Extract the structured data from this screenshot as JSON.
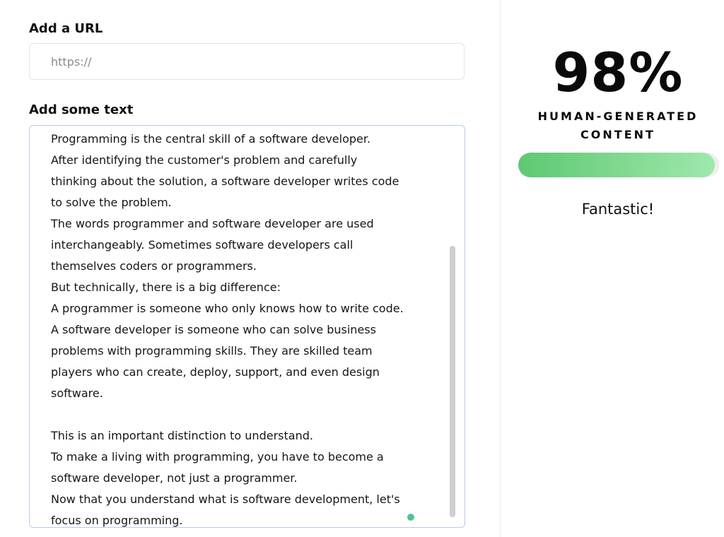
{
  "url_section": {
    "label": "Add a URL",
    "placeholder": "https://"
  },
  "text_section": {
    "label": "Add some text",
    "lines": [
      "Programming is the central skill of a software developer.",
      "After identifying the customer's problem and carefully",
      "thinking about the solution, a software developer writes code",
      "to solve the problem.",
      "The words programmer and software developer are used",
      "interchangeably. Sometimes software developers call",
      "themselves coders or programmers.",
      "But technically, there is a big difference:",
      "A programmer is someone who only knows how to write code.",
      "A software developer is someone who can solve business",
      "problems with programming skills. They are skilled team",
      "players who can create, deploy, support, and even design",
      "software.",
      "",
      "This is an important distinction to understand.",
      "To make a living with programming, you have to become a",
      "software developer, not just a programmer.",
      "Now that you understand what is software development, let's",
      "focus on programming."
    ]
  },
  "result": {
    "score": "98%",
    "caption_line1": "HUMAN-GENERATED",
    "caption_line2": "CONTENT",
    "progress_percent": 98,
    "verdict": "Fantastic!"
  },
  "colors": {
    "progress_start": "#5ec872",
    "progress_end": "#9fe8ac",
    "text_box_border": "#b9c9f3",
    "status_dot": "#4ec193"
  }
}
